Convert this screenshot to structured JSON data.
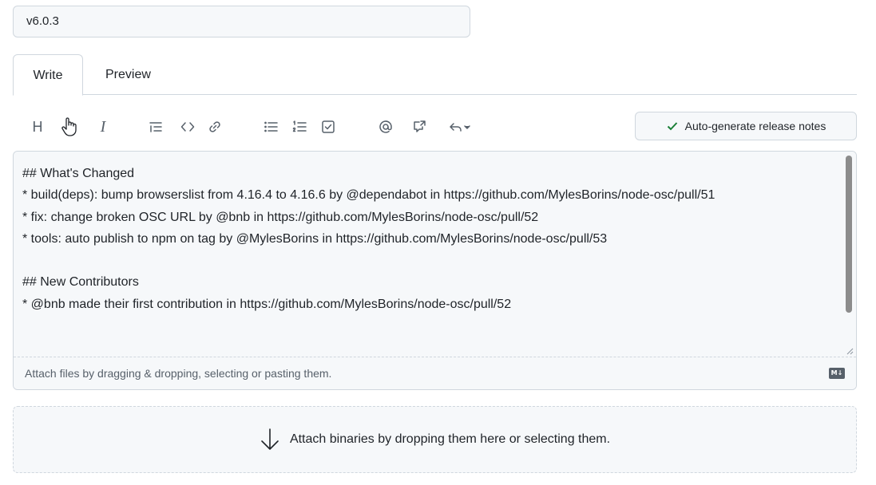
{
  "release": {
    "title_value": "v6.0.3"
  },
  "tabs": [
    {
      "label": "Write",
      "active": true
    },
    {
      "label": "Preview",
      "active": false
    }
  ],
  "toolbar": {
    "buttons": [
      {
        "name": "heading",
        "icon": "heading-icon",
        "glyph": "H"
      },
      {
        "name": "bold",
        "icon": "bold-icon"
      },
      {
        "name": "italic",
        "icon": "italic-icon",
        "glyph": "I"
      },
      {
        "name": "quote",
        "icon": "quote-icon"
      },
      {
        "name": "code",
        "icon": "code-icon"
      },
      {
        "name": "link",
        "icon": "link-icon"
      },
      {
        "name": "unordered-list",
        "icon": "list-unordered-icon"
      },
      {
        "name": "ordered-list",
        "icon": "list-ordered-icon"
      },
      {
        "name": "task-list",
        "icon": "tasklist-icon"
      },
      {
        "name": "mention",
        "icon": "mention-icon"
      },
      {
        "name": "cross-reference",
        "icon": "cross-reference-icon"
      },
      {
        "name": "saved-replies",
        "icon": "reply-icon"
      }
    ],
    "auto_generate_label": "Auto-generate release notes",
    "accent_color": "#1a7f37"
  },
  "editor": {
    "content": "## What's Changed\n* build(deps): bump browserslist from 4.16.4 to 4.16.6 by @dependabot in https://github.com/MylesBorins/node-osc/pull/51\n* fix: change broken OSC URL by @bnb in https://github.com/MylesBorins/node-osc/pull/52\n* tools: auto publish to npm on tag by @MylesBorins in https://github.com/MylesBorins/node-osc/pull/53\n\n## New Contributors\n* @bnb made their first contribution in https://github.com/MylesBorins/node-osc/pull/52",
    "footer_text": "Attach files by dragging & dropping, selecting or pasting them.",
    "markdown_badge": "M↓"
  },
  "dropzone": {
    "label": "Attach binaries by dropping them here or selecting them.",
    "icon": "arrow-down-icon"
  }
}
